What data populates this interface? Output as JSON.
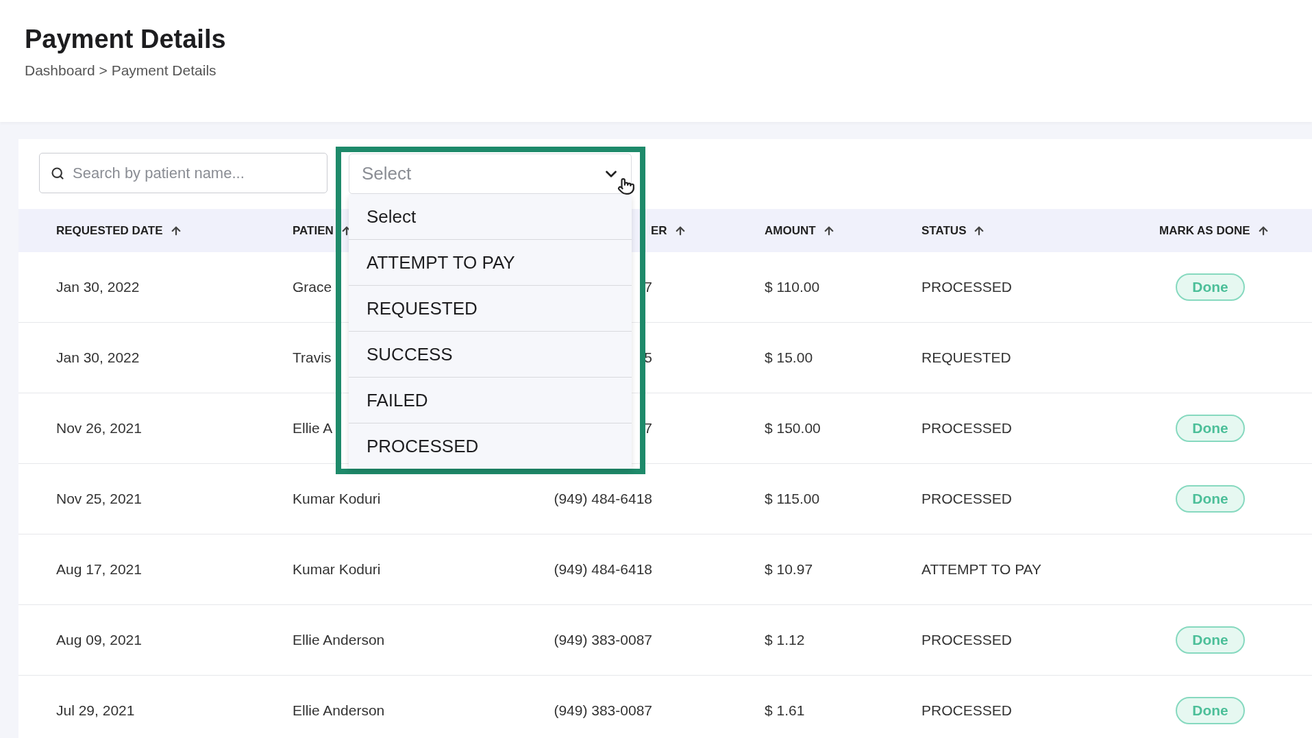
{
  "page": {
    "title": "Payment Details",
    "breadcrumb": "Dashboard > Payment Details"
  },
  "filters": {
    "search": {
      "placeholder": "Search by patient name..."
    },
    "status_select": {
      "value": "Select",
      "expanded": true,
      "options": [
        {
          "label": "Select"
        },
        {
          "label": "ATTEMPT TO PAY"
        },
        {
          "label": "REQUESTED"
        },
        {
          "label": "SUCCESS"
        },
        {
          "label": "FAILED"
        },
        {
          "label": "PROCESSED"
        }
      ]
    }
  },
  "table": {
    "columns": [
      "REQUESTED DATE",
      "PATIEN",
      "ER",
      "AMOUNT",
      "STATUS",
      "MARK AS DONE"
    ],
    "rows": [
      {
        "cells": [
          "Jan 30, 2022",
          "Grace",
          "7",
          "$ 110.00",
          "PROCESSED"
        ],
        "action": "Done"
      },
      {
        "cells": [
          "Jan 30, 2022",
          "Travis",
          "5",
          "$ 15.00",
          "REQUESTED"
        ]
      },
      {
        "cells": [
          "Nov 26, 2021",
          "Ellie A",
          "7",
          "$ 150.00",
          "PROCESSED"
        ],
        "action": "Done"
      },
      {
        "cells": [
          "Nov 25, 2021",
          "Kumar Koduri",
          "(949) 484-6418",
          "$ 115.00",
          "PROCESSED"
        ],
        "action": "Done"
      },
      {
        "cells": [
          "Aug 17, 2021",
          "Kumar Koduri",
          "(949) 484-6418",
          "$ 10.97",
          "ATTEMPT TO PAY"
        ]
      },
      {
        "cells": [
          "Aug 09, 2021",
          "Ellie Anderson",
          "(949) 383-0087",
          "$ 1.12",
          "PROCESSED"
        ],
        "action": "Done"
      },
      {
        "cells": [
          "Jul 29, 2021",
          "Ellie Anderson",
          "(949) 383-0087",
          "$ 1.61",
          "PROCESSED"
        ],
        "action": "Done"
      }
    ]
  }
}
